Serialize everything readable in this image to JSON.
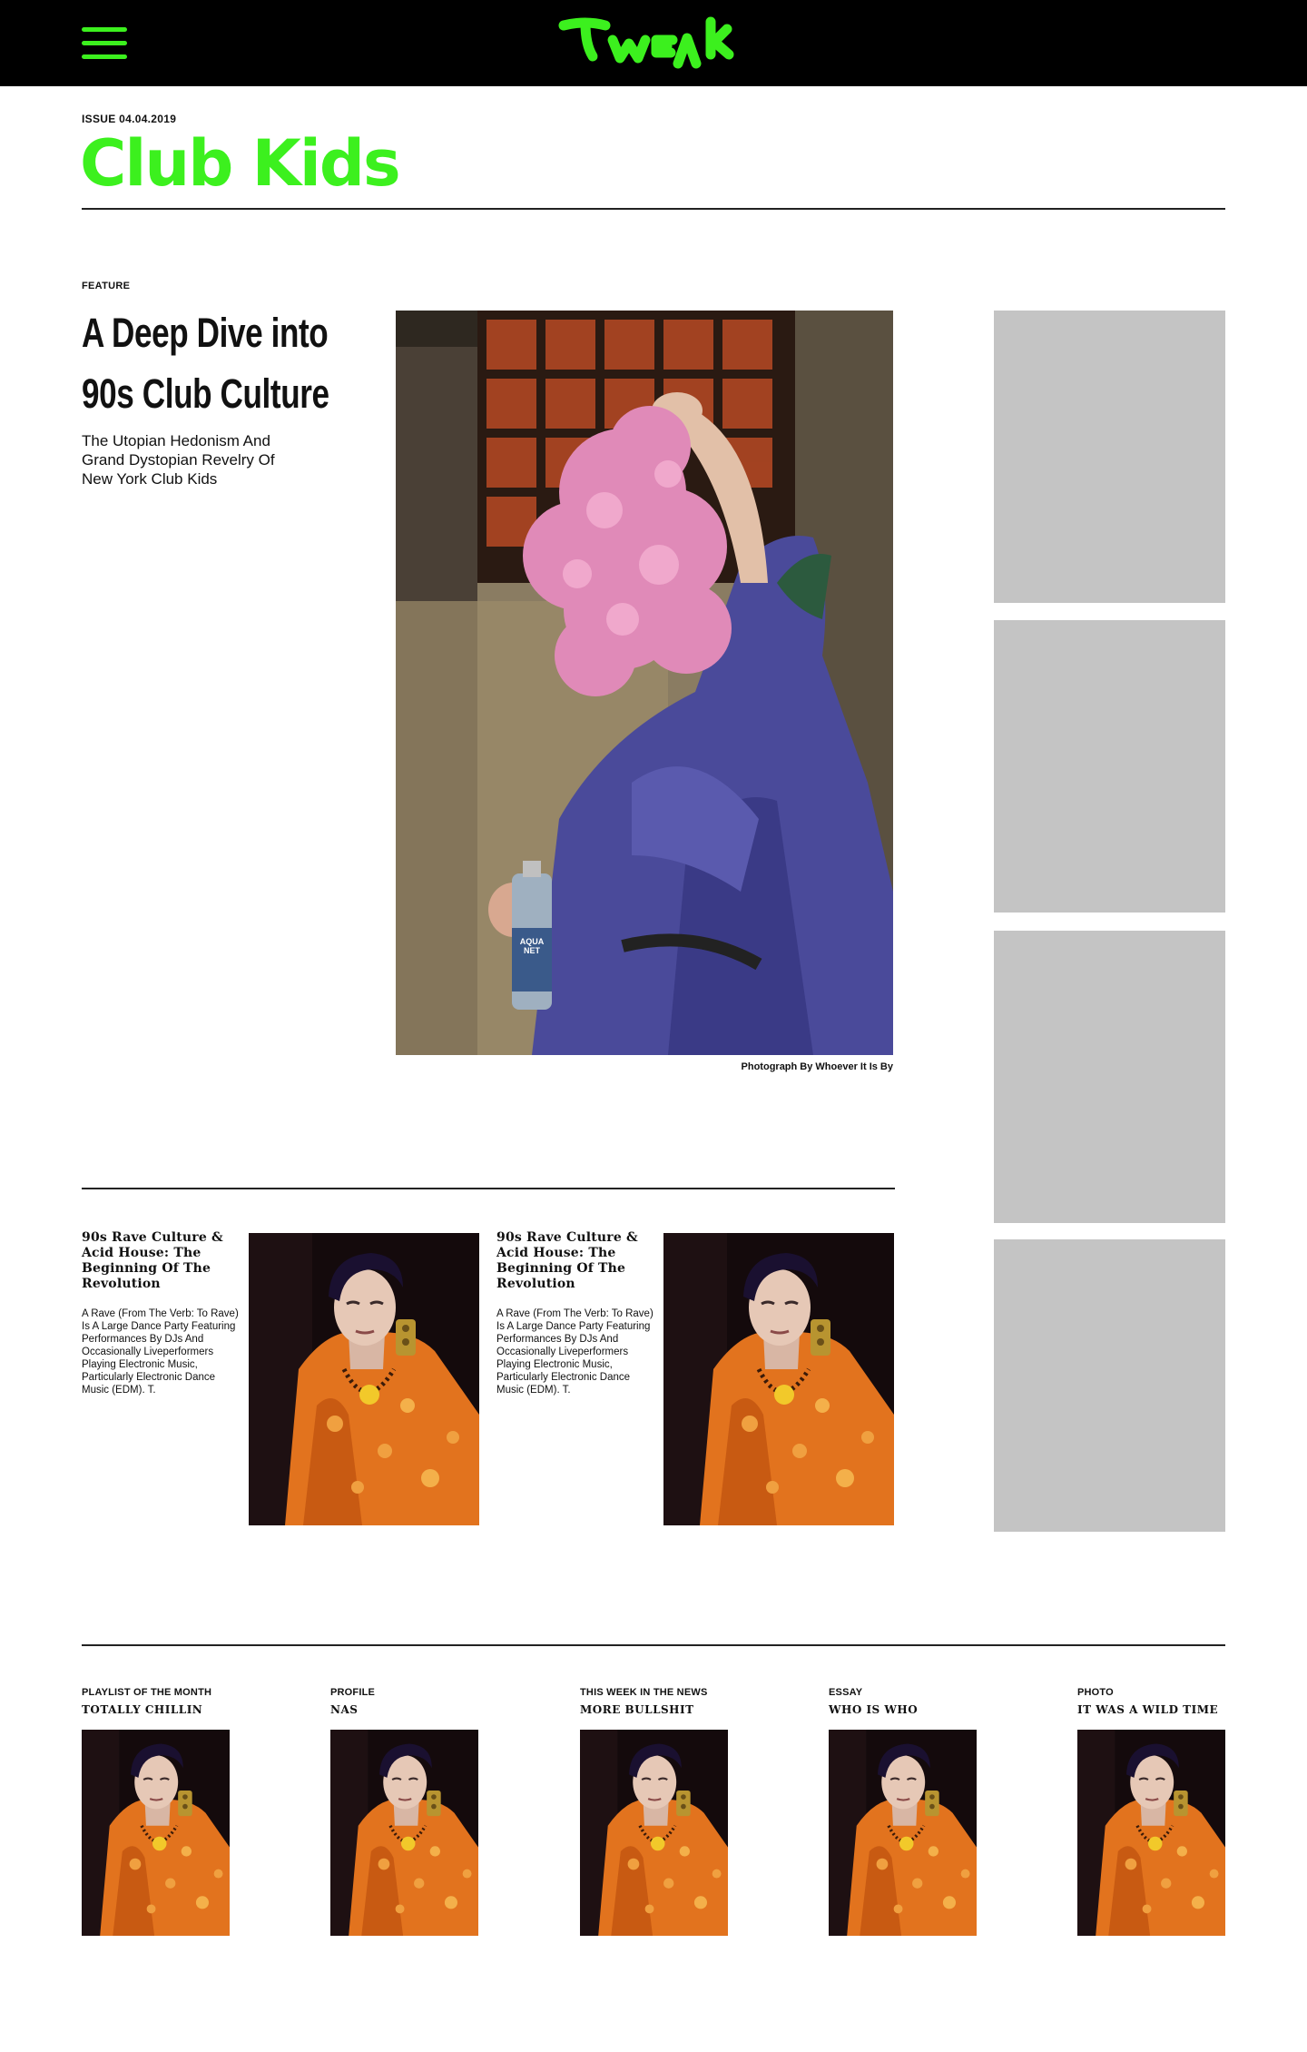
{
  "brand": {
    "logo_text": "TWEAK",
    "accent": "#3cf01e"
  },
  "issue": {
    "label": "ISSUE 04.04.2019",
    "title": "Club Kids"
  },
  "feature": {
    "tag": "FEATURE",
    "title_line1": "A Deep Dive into",
    "title_line2": "90s Club Culture",
    "subtitle": "The Utopian Hedonism And Grand Dystopian Revelry Of New York Club Kids",
    "image_caption": "Photograph By Whoever It Is By",
    "spray_can_text": "AQUA NET"
  },
  "stories": [
    {
      "title": "90s Rave Culture & Acid House: The Beginning Of The Revolution",
      "description": "A Rave (From The Verb: To Rave) Is A Large Dance Party Featuring Performances By DJs And Occasionally Liveperformers Playing Electronic Music, Particularly Electronic Dance Music (EDM). T."
    },
    {
      "title": "90s Rave Culture & Acid House: The Beginning Of The Revolution",
      "description": "A Rave (From The Verb: To Rave) Is A Large Dance Party Featuring Performances By DJs And Occasionally Liveperformers Playing Electronic Music, Particularly Electronic Dance Music (EDM). T."
    }
  ],
  "categories": [
    {
      "label": "PLAYLIST OF THE MONTH",
      "title": "TOTALLY CHILLIN"
    },
    {
      "label": "PROFILE",
      "title": "NAS"
    },
    {
      "label": "THIS WEEK IN THE NEWS",
      "title": "MORE BULLSHIT"
    },
    {
      "label": "ESSAY",
      "title": "WHO IS WHO"
    },
    {
      "label": "PHOTO",
      "title": "IT WAS A WILD TIME"
    }
  ],
  "icons": {
    "menu": "hamburger-menu-icon"
  }
}
